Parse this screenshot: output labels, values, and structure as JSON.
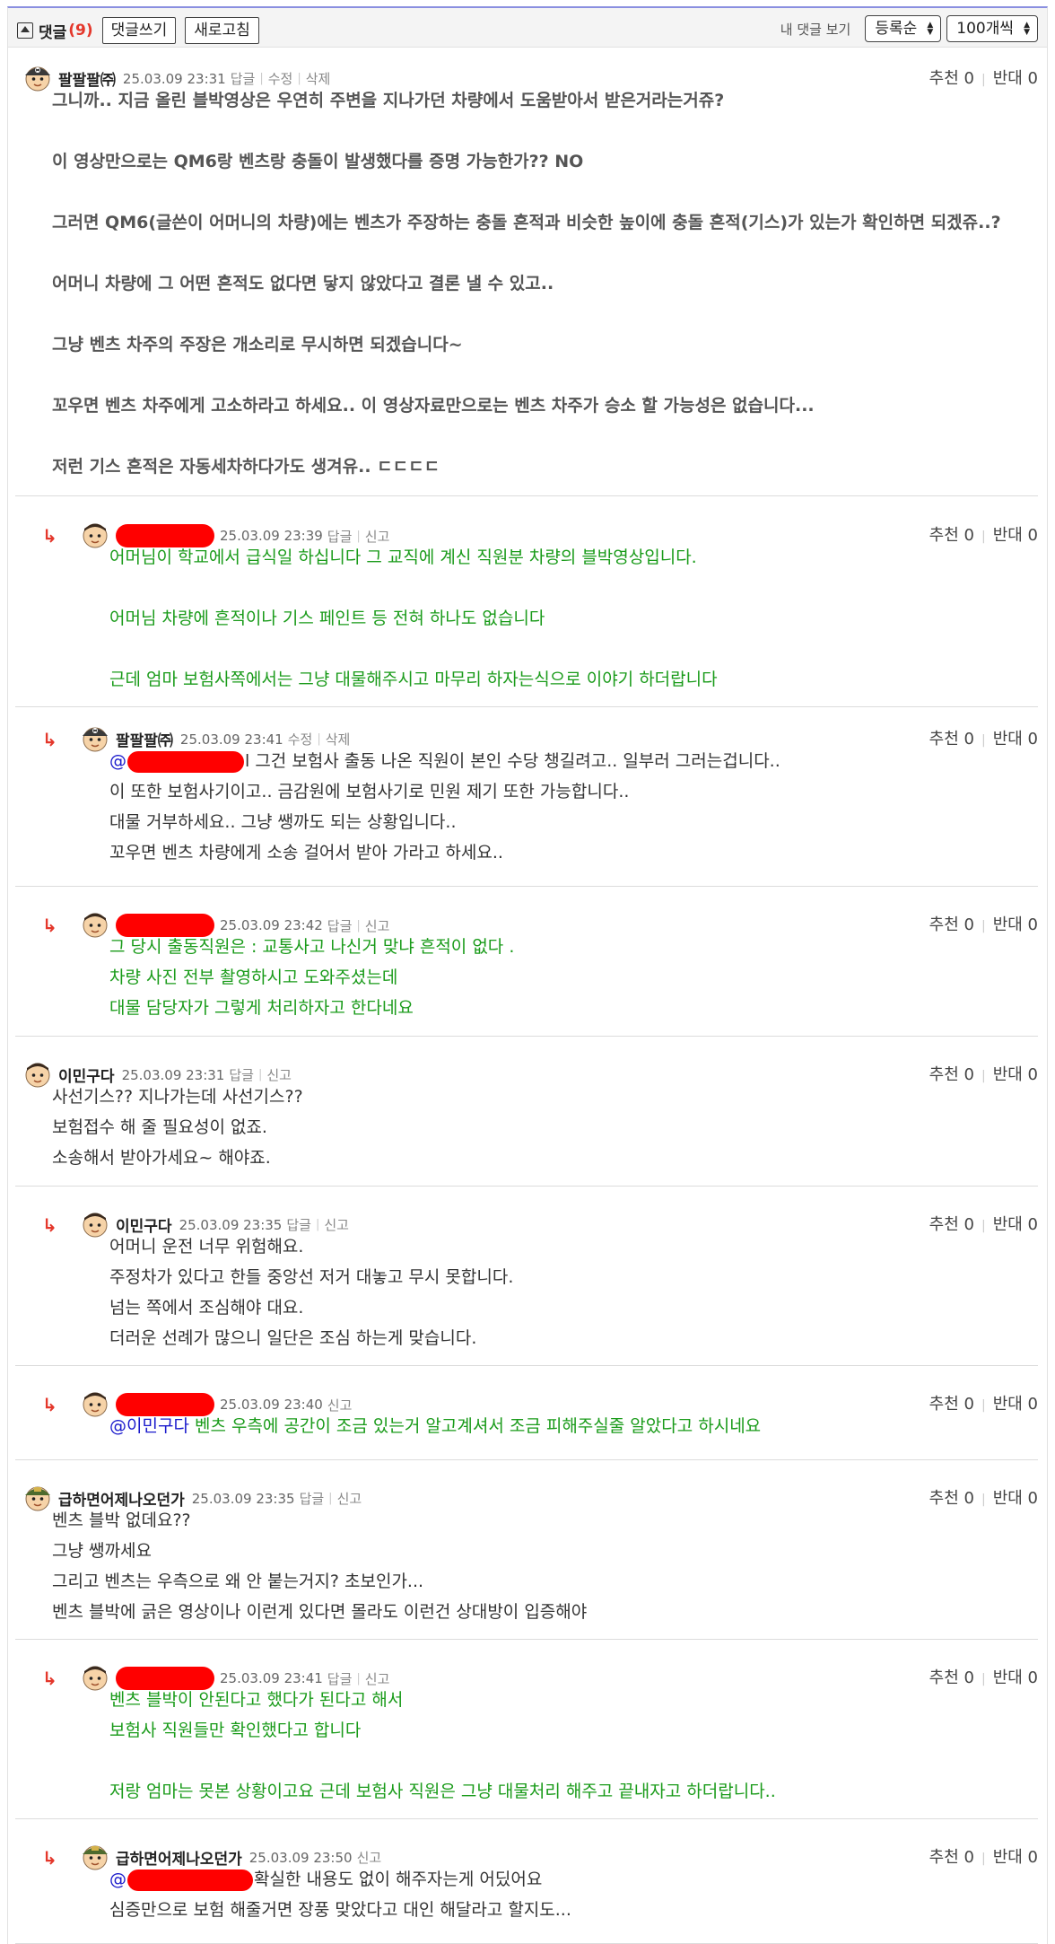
{
  "toolbar": {
    "title": "댓글",
    "count": "(9)",
    "write_label": "댓글쓰기",
    "refresh_label": "새로고침",
    "my_comments_label": "내 댓글 보기",
    "sort_value": "등록순",
    "per_page_value": "100개씩"
  },
  "vote_labels": {
    "up": "추천",
    "down": "반대"
  },
  "action_labels": {
    "reply": "답글",
    "edit": "수정",
    "delete": "삭제",
    "report": "신고"
  },
  "reply_glyph": "↳",
  "colors": {
    "accent_red": "#e4372b",
    "reply_green": "#1a9b1a",
    "mention_blue": "#1a1acc",
    "redaction": "#ff0000"
  },
  "comments": [
    {
      "nick": "팔팔팔㈜",
      "date": "25.03.09 23:31",
      "up": "0",
      "down": "0",
      "lines": [
        "그니까.. 지금 올린 블박영상은 우연히 주변을 지나가던 차량에서 도움받아서 받은거라는거쥬?",
        "",
        "이 영상만으로는 QM6랑 벤츠랑 충돌이 발생했다를 증명 가능한가?? NO",
        "",
        "그러면 QM6(글쓴이 어머니의 차량)에는 벤츠가 주장하는 충돌 흔적과 비슷한 높이에 충돌 흔적(기스)가 있는가 확인하면 되겠쥬..?",
        "",
        "어머니 차량에 그 어떤 흔적도 없다면 닿지 않았다고 결론 낼 수 있고..",
        "",
        "그냥 벤츠 차주의 주장은 개소리로 무시하면 되겠습니다~",
        "",
        "꼬우면 벤츠 차주에게 고소하라고 하세요.. 이 영상자료만으로는 벤츠 차주가 승소 할 가능성은 없습니다...",
        "",
        "저런 기스 흔적은 자동세차하다가도 생겨유.. ㄷㄷㄷㄷ"
      ]
    },
    {
      "nick": "",
      "date": "25.03.09 23:39",
      "up": "0",
      "down": "0",
      "lines": [
        "어머님이 학교에서 급식일 하십니다 그 교직에 계신 직원분 차량의 블박영상입니다.",
        "",
        "어머님 차량에 흔적이나 기스 페인트 등 전혀 하나도 없습니다",
        "",
        "근데 엄마 보험사쪽에서는 그냥 대물해주시고 마무리 하자는식으로 이야기 하더랍니다"
      ]
    },
    {
      "nick": "팔팔팔㈜",
      "date": "25.03.09 23:41",
      "up": "0",
      "down": "0",
      "mention": "@",
      "lines": [
        "l 그건 보험사 출동 나온 직원이 본인 수당 챙길려고.. 일부러 그러는겁니다..",
        "이 또한 보험사기이고.. 금감원에 보험사기로 민원 제기 또한 가능합니다..",
        "대물 거부하세요.. 그냥 쌩까도 되는 상황입니다..",
        "꼬우면 벤츠 차량에게 소송 걸어서 받아 가라고 하세요.."
      ]
    },
    {
      "nick": "",
      "date": "25.03.09 23:42",
      "up": "0",
      "down": "0",
      "lines": [
        "그 당시 출동직원은 : 교통사고 나신거 맞냐 흔적이 없다 .",
        "차량 사진 전부 촬영하시고 도와주셨는데",
        "대물 담당자가 그렇게 처리하자고 한다네요"
      ]
    },
    {
      "nick": "이민구다",
      "date": "25.03.09 23:31",
      "up": "0",
      "down": "0",
      "lines": [
        "사선기스?? 지나가는데 사선기스??",
        "보험접수 해 줄 필요성이 없죠.",
        "소송해서 받아가세요~ 해야죠."
      ]
    },
    {
      "nick": "이민구다",
      "date": "25.03.09 23:35",
      "up": "0",
      "down": "0",
      "lines": [
        "어머니 운전 너무 위험해요.",
        "주정차가 있다고 한들 중앙선 저거 대놓고 무시 못합니다.",
        "넘는 쪽에서 조심해야 대요.",
        "더러운 선례가 많으니 일단은 조심 하는게 맞습니다."
      ]
    },
    {
      "nick": "",
      "date": "25.03.09 23:40",
      "up": "0",
      "down": "0",
      "mention": "@이민구다",
      "lines": [
        " 벤츠 우측에 공간이 조금 있는거 알고계셔서 조금 피해주실줄 알았다고 하시네요"
      ]
    },
    {
      "nick": "급하면어제나오던가",
      "date": "25.03.09 23:35",
      "up": "0",
      "down": "0",
      "lines": [
        "벤츠 블박 없데요??",
        "그냥 쌩까세요",
        "그리고 벤츠는 우측으로 왜 안 붙는거지? 초보인가...",
        "벤츠 블박에 긁은 영상이나 이런게 있다면 몰라도 이런건 상대방이 입증해야"
      ]
    },
    {
      "nick": "",
      "date": "25.03.09 23:41",
      "up": "0",
      "down": "0",
      "lines": [
        "벤츠 블박이 안된다고 했다가 된다고 해서",
        "보험사 직원들만 확인했다고 합니다",
        "",
        "저랑 엄마는 못본 상황이고요 근데 보험사 직원은 그냥 대물처리 해주고 끝내자고 하더랍니다.."
      ]
    },
    {
      "nick": "급하면어제나오던가",
      "date": "25.03.09 23:50",
      "up": "0",
      "down": "0",
      "mention": "@",
      "lines": [
        "확실한 내용도 없이 해주자는게 어딨어요",
        "심증만으로 보험 해줄거면 장풍 맞았다고 대인 해달라고 할지도..."
      ]
    }
  ]
}
